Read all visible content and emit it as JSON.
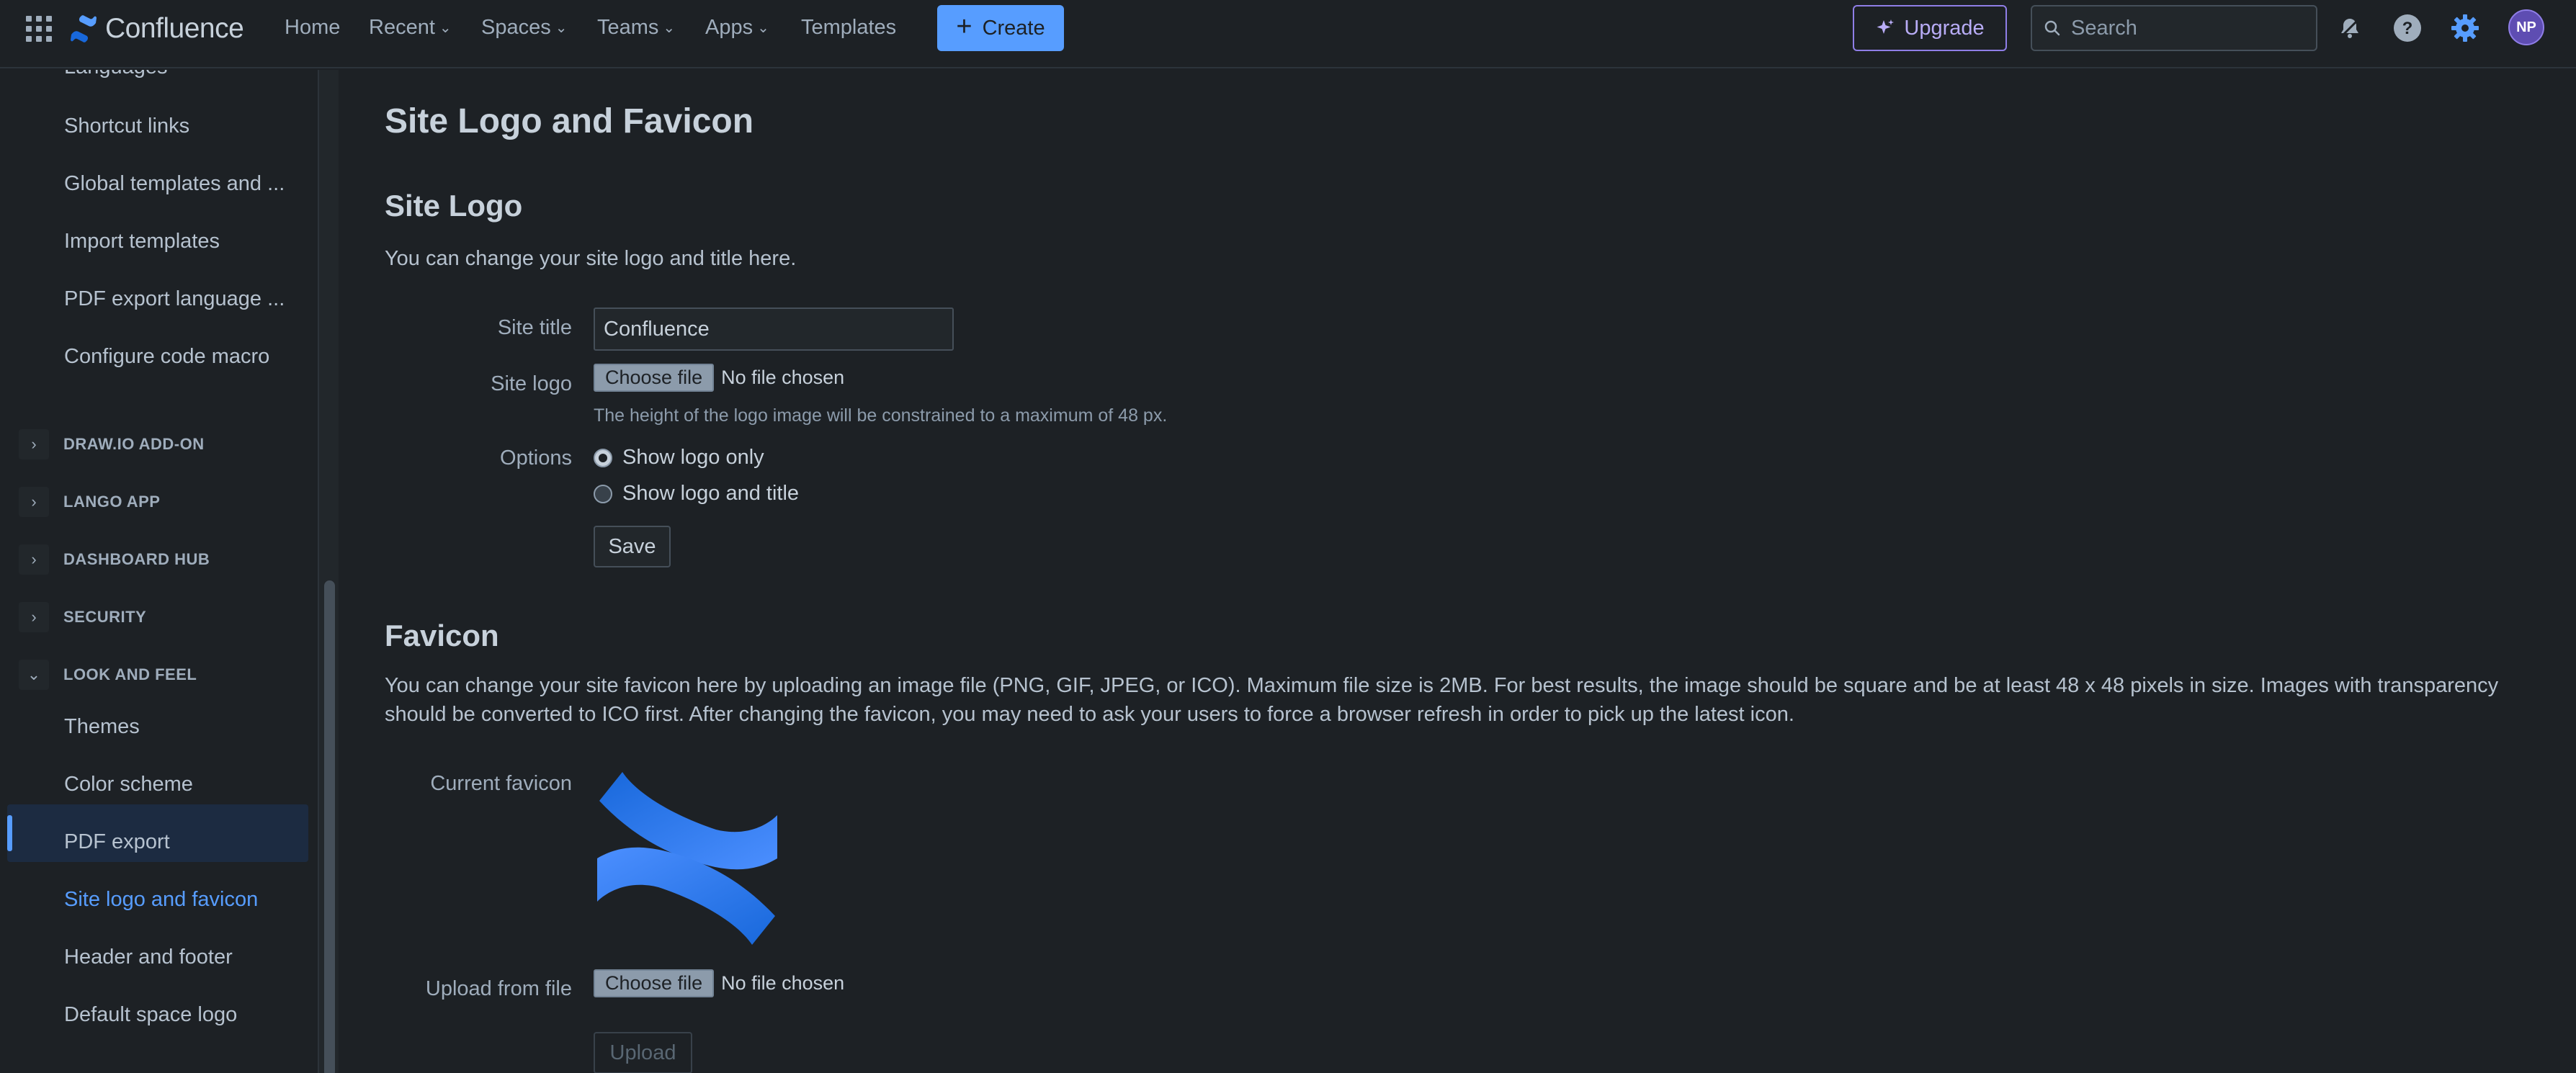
{
  "topnav": {
    "brand": "Confluence",
    "items": [
      {
        "label": "Home",
        "has_chevron": false
      },
      {
        "label": "Recent",
        "has_chevron": true
      },
      {
        "label": "Spaces",
        "has_chevron": true
      },
      {
        "label": "Teams",
        "has_chevron": true
      },
      {
        "label": "Apps",
        "has_chevron": true
      },
      {
        "label": "Templates",
        "has_chevron": false
      }
    ],
    "create_label": "Create",
    "upgrade_label": "Upgrade",
    "search_placeholder": "Search",
    "avatar_initials": "NP",
    "icons": [
      "app-switcher-icon",
      "notifications-icon",
      "help-icon",
      "settings-icon"
    ]
  },
  "sidebar": {
    "links_top": [
      "Languages",
      "Shortcut links",
      "Global templates and ...",
      "Import templates",
      "PDF export language ...",
      "Configure code macro"
    ],
    "sections": [
      {
        "label": "DRAW.IO ADD-ON",
        "expanded": false
      },
      {
        "label": "LANGO APP",
        "expanded": false
      },
      {
        "label": "DASHBOARD HUB",
        "expanded": false
      },
      {
        "label": "SECURITY",
        "expanded": false
      },
      {
        "label": "LOOK AND FEEL",
        "expanded": true
      }
    ],
    "look_and_feel_items": [
      "Themes",
      "Color scheme",
      "PDF export",
      "Site logo and favicon",
      "Header and footer",
      "Default space logo"
    ],
    "active_item": "Site logo and favicon"
  },
  "main": {
    "page_title": "Site Logo and Favicon",
    "site_logo": {
      "heading": "Site Logo",
      "description": "You can change your site logo and title here.",
      "site_title_label": "Site title",
      "site_title_value": "Confluence",
      "site_logo_label": "Site logo",
      "choose_file_label": "Choose file",
      "no_file_text": "No file chosen",
      "hint": "The height of the logo image will be constrained to a maximum of 48 px.",
      "options_label": "Options",
      "options": [
        {
          "label": "Show logo only",
          "checked": true
        },
        {
          "label": "Show logo and title",
          "checked": false
        }
      ],
      "save_label": "Save"
    },
    "favicon": {
      "heading": "Favicon",
      "description_line1": "You can change your site favicon here by uploading an image file (PNG, GIF, JPEG, or ICO). Maximum file size is 2MB. For best results, the image should be square and be at least 48 x 48 pixels in size. Images with transparency",
      "description_line2": "should be converted to ICO first. After changing the favicon, you may need to ask your users to force a browser refresh in order to pick up the latest icon.",
      "current_favicon_label": "Current favicon",
      "upload_label": "Upload from file",
      "choose_file_label": "Choose file",
      "no_file_text": "No file chosen",
      "upload_button": "Upload"
    }
  },
  "colors": {
    "background": "#1d2125",
    "accent": "#579dff",
    "upgrade": "#8f7ee7",
    "avatar": "#5e4db2",
    "active_nav": "#1c2b41"
  }
}
